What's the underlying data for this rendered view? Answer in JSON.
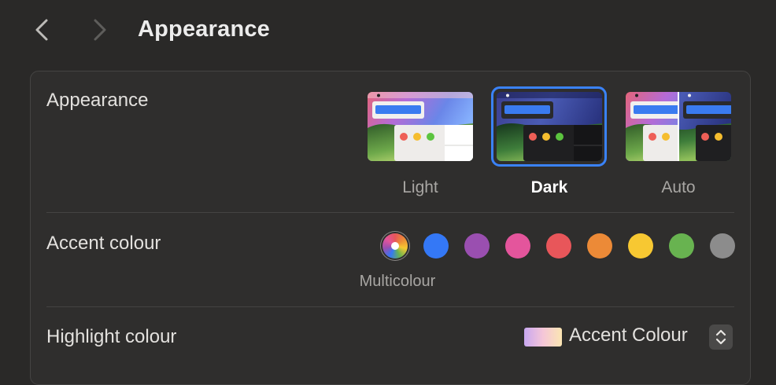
{
  "window": {
    "title": "Appearance"
  },
  "nav": {
    "back_icon": "chevron-left-icon",
    "forward_icon": "chevron-right-icon"
  },
  "appearance": {
    "label": "Appearance",
    "options": [
      {
        "label": "Light",
        "selected": false
      },
      {
        "label": "Dark",
        "selected": true
      },
      {
        "label": "Auto",
        "selected": false
      }
    ]
  },
  "accent": {
    "label": "Accent colour",
    "selected_label": "Multicolour",
    "colors": [
      {
        "name": "multicolour",
        "hex": "multicolour"
      },
      {
        "name": "blue",
        "hex": "#3478f6"
      },
      {
        "name": "purple",
        "hex": "#9a4fb0"
      },
      {
        "name": "pink",
        "hex": "#e4559c"
      },
      {
        "name": "red",
        "hex": "#e8565a"
      },
      {
        "name": "orange",
        "hex": "#ec8a37"
      },
      {
        "name": "yellow",
        "hex": "#f7c832"
      },
      {
        "name": "green",
        "hex": "#68b350"
      },
      {
        "name": "graphite",
        "hex": "#8c8c8c"
      }
    ]
  },
  "highlight": {
    "label": "Highlight colour",
    "value": "Accent Colour"
  },
  "colors": {
    "accent": "#3a82f7",
    "background": "#2a2928",
    "panel": "#2f2e2d"
  }
}
